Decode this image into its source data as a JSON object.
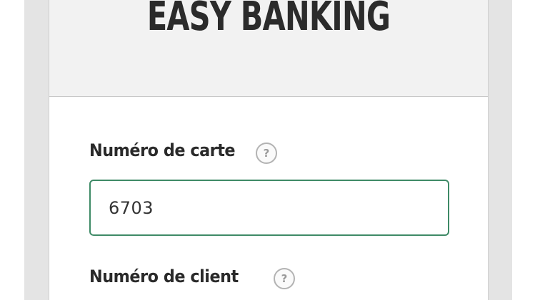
{
  "header": {
    "title": "EASY BANKING"
  },
  "form": {
    "card_number": {
      "label": "Numéro de carte",
      "help_icon": "question-mark",
      "help_glyph": "?",
      "value": "6703"
    },
    "client_number": {
      "label": "Numéro de client",
      "help_icon": "question-mark",
      "help_glyph": "?"
    }
  },
  "colors": {
    "input_border": "#3e8a66",
    "header_bg": "#f2f2f2",
    "frame_bg": "#e4e4e4",
    "text": "#2a2a2a"
  }
}
